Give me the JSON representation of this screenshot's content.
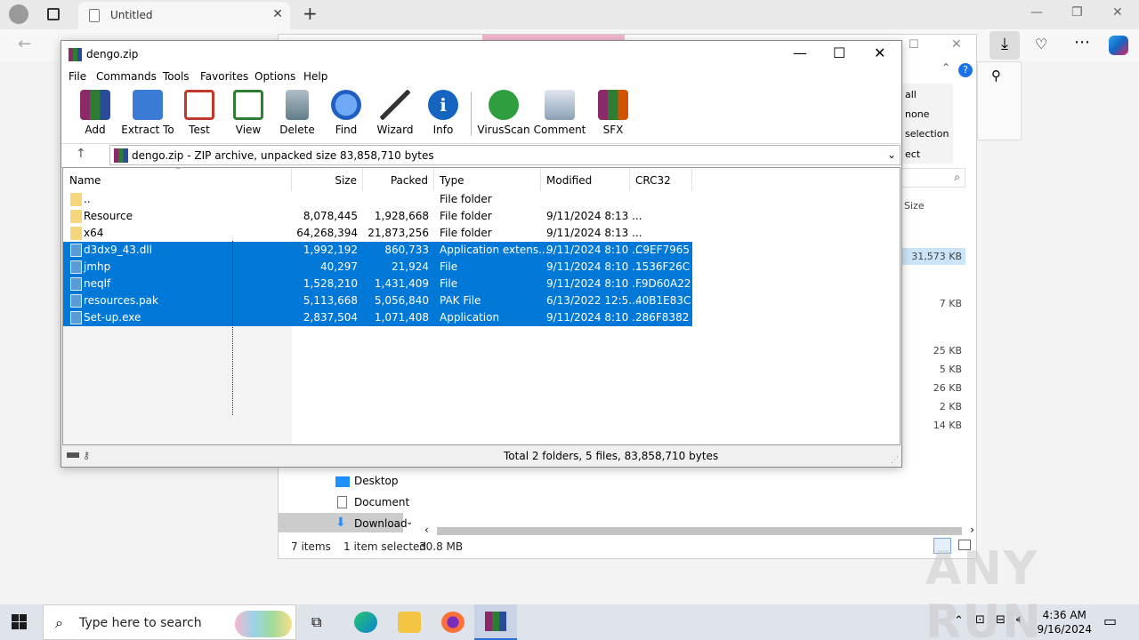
{
  "browser": {
    "tab_title": "Untitled",
    "new_tab": "+",
    "minimize": "—",
    "restore": "❐",
    "close": "✕"
  },
  "explorer": {
    "right_panel": [
      "all",
      "none",
      "selection",
      "ect"
    ],
    "size_header": "Size",
    "sizes": [
      "31,573 KB",
      "7 KB",
      "25 KB",
      "5 KB",
      "26 KB",
      "2 KB",
      "14 KB"
    ],
    "nav": [
      "Desktop",
      "Document",
      "Download"
    ],
    "status_items": "7 items",
    "status_selected": "1 item selected",
    "status_size": "30.8 MB"
  },
  "winrar": {
    "title": "dengo.zip",
    "menu": [
      "File",
      "Commands",
      "Tools",
      "Favorites",
      "Options",
      "Help"
    ],
    "toolbar": [
      {
        "label": "Add",
        "icon": "add-icon",
        "color": "#8a2a6a"
      },
      {
        "label": "Extract To",
        "icon": "extract-folder-icon",
        "color": "#3a7bd5"
      },
      {
        "label": "Test",
        "icon": "test-checklist-icon",
        "color": "#c0392b"
      },
      {
        "label": "View",
        "icon": "view-book-icon",
        "color": "#2e7d32"
      },
      {
        "label": "Delete",
        "icon": "delete-trash-icon",
        "color": "#7f8c8d"
      },
      {
        "label": "Find",
        "icon": "find-magnifier-icon",
        "color": "#2a6fd6"
      },
      {
        "label": "Wizard",
        "icon": "wizard-wand-icon",
        "color": "#8e44ad"
      },
      {
        "label": "Info",
        "icon": "info-icon",
        "color": "#1565c0"
      },
      {
        "label": "VirusScan",
        "icon": "virusscan-bug-icon",
        "color": "#2e9e3e"
      },
      {
        "label": "Comment",
        "icon": "comment-icon",
        "color": "#8aa0b8"
      },
      {
        "label": "SFX",
        "icon": "sfx-box-icon",
        "color": "#d35400"
      }
    ],
    "path": "dengo.zip - ZIP archive, unpacked size 83,858,710 bytes",
    "columns": [
      "Name",
      "Size",
      "Packed",
      "Type",
      "Modified",
      "CRC32"
    ],
    "rows": [
      {
        "name": "..",
        "size": "",
        "packed": "",
        "type": "File folder",
        "modified": "",
        "crc": "",
        "kind": "folder",
        "selected": false
      },
      {
        "name": "Resource",
        "size": "8,078,445",
        "packed": "1,928,668",
        "type": "File folder",
        "modified": "9/11/2024 8:13 ...",
        "crc": "",
        "kind": "folder",
        "selected": false
      },
      {
        "name": "x64",
        "size": "64,268,394",
        "packed": "21,873,256",
        "type": "File folder",
        "modified": "9/11/2024 8:13 ...",
        "crc": "",
        "kind": "folder",
        "selected": false
      },
      {
        "name": "d3dx9_43.dll",
        "size": "1,992,192",
        "packed": "860,733",
        "type": "Application extens...",
        "modified": "9/11/2024 8:10 ...",
        "crc": "C9EF7965",
        "kind": "file",
        "selected": true
      },
      {
        "name": "jmhp",
        "size": "40,297",
        "packed": "21,924",
        "type": "File",
        "modified": "9/11/2024 8:10 ...",
        "crc": "1536F26C",
        "kind": "file",
        "selected": true
      },
      {
        "name": "neqlf",
        "size": "1,528,210",
        "packed": "1,431,409",
        "type": "File",
        "modified": "9/11/2024 8:10 ...",
        "crc": "F9D60A22",
        "kind": "file",
        "selected": true
      },
      {
        "name": "resources.pak",
        "size": "5,113,668",
        "packed": "5,056,840",
        "type": "PAK File",
        "modified": "6/13/2022 12:5...",
        "crc": "40B1E83C",
        "kind": "file",
        "selected": true
      },
      {
        "name": "Set-up.exe",
        "size": "2,837,504",
        "packed": "1,071,408",
        "type": "Application",
        "modified": "9/11/2024 8:10 ...",
        "crc": "286F8382",
        "kind": "file",
        "selected": true
      }
    ],
    "status": "Total 2 folders, 5 files, 83,858,710 bytes"
  },
  "taskbar": {
    "search_placeholder": "Type here to search",
    "time": "4:36 AM",
    "date": "9/16/2024"
  },
  "watermark": "ANY RUN"
}
